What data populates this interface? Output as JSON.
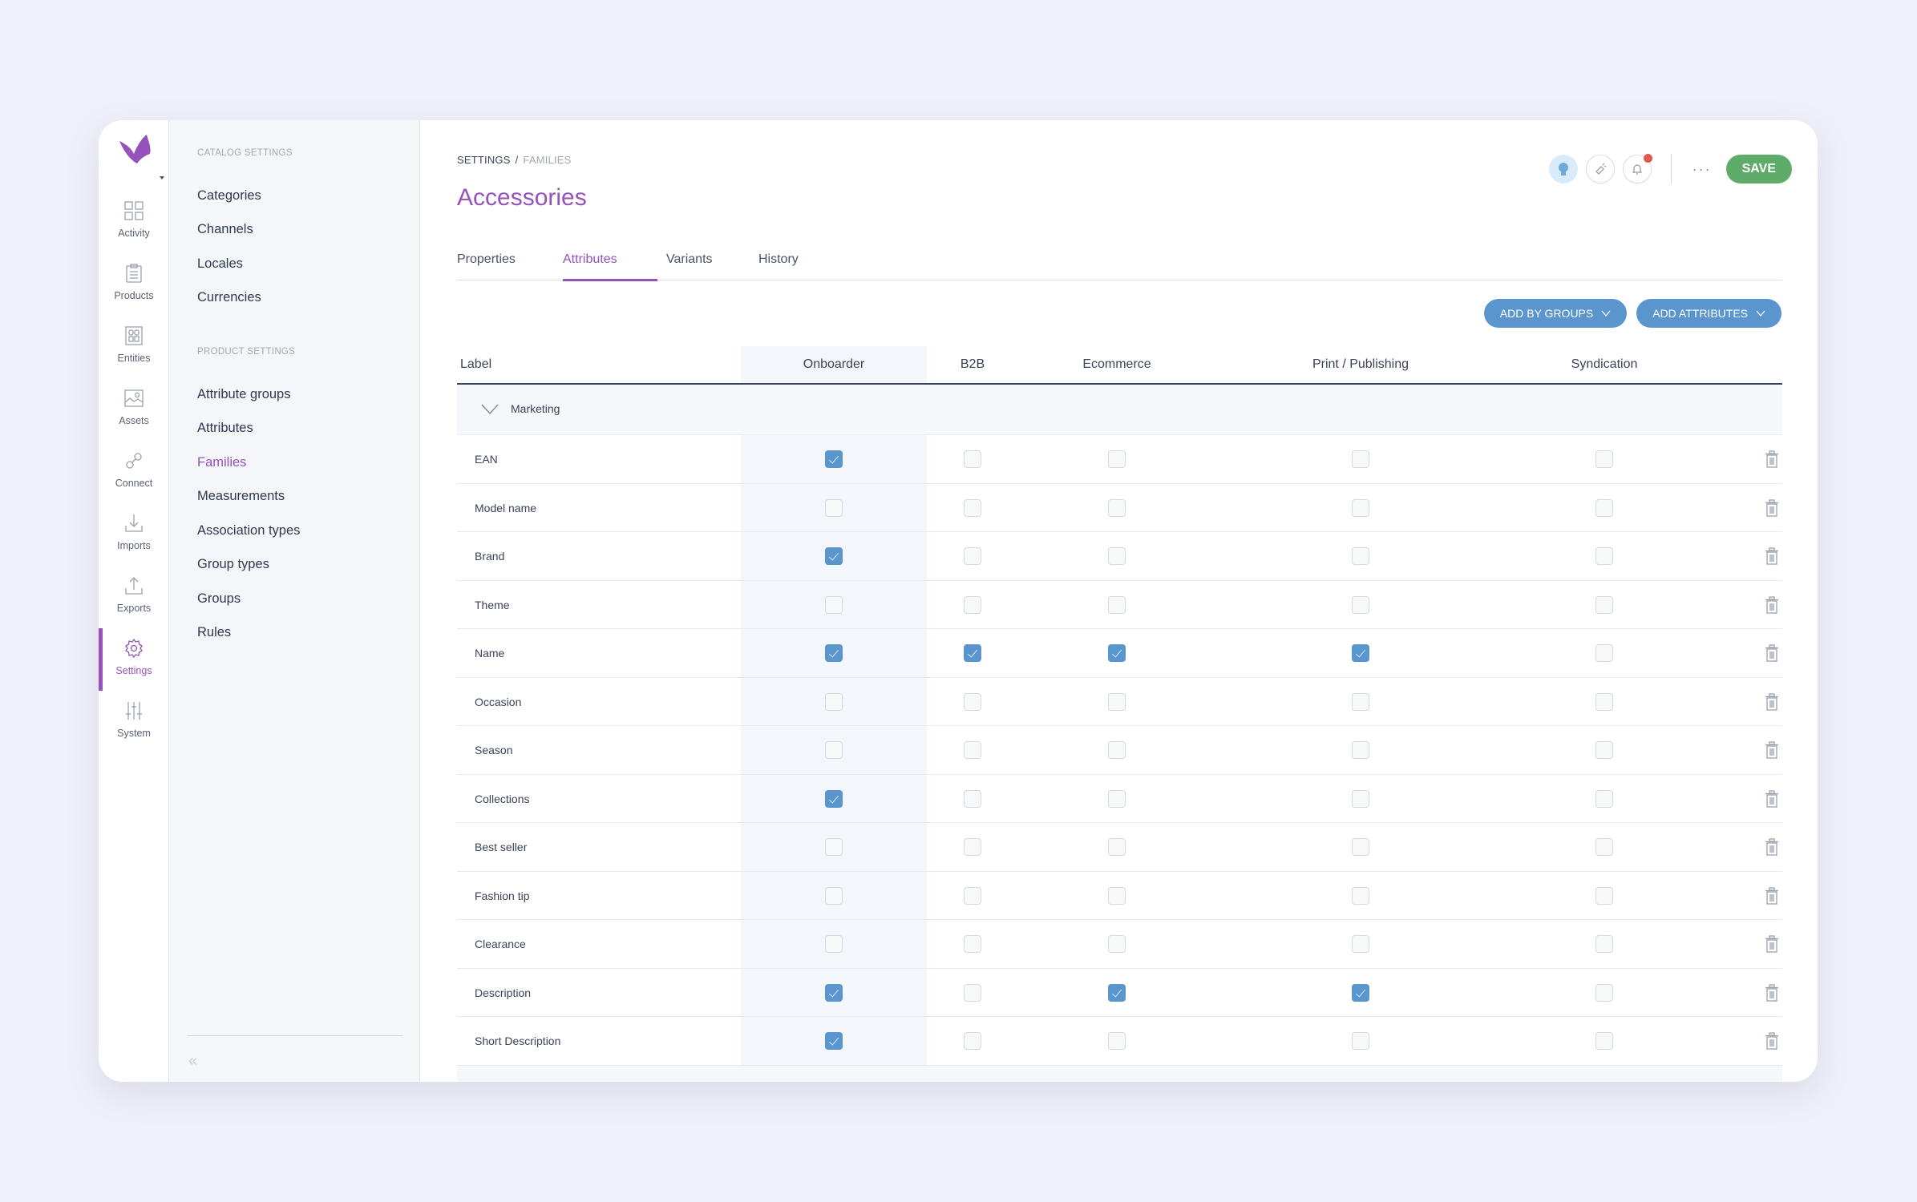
{
  "rail": {
    "items": [
      {
        "label": "Activity",
        "icon": "grid-icon"
      },
      {
        "label": "Products",
        "icon": "clipboard-icon"
      },
      {
        "label": "Entities",
        "icon": "entities-icon"
      },
      {
        "label": "Assets",
        "icon": "image-icon"
      },
      {
        "label": "Connect",
        "icon": "link-icon"
      },
      {
        "label": "Imports",
        "icon": "import-icon"
      },
      {
        "label": "Exports",
        "icon": "export-icon"
      },
      {
        "label": "Settings",
        "icon": "gear-icon",
        "active": true
      },
      {
        "label": "System",
        "icon": "sliders-icon"
      }
    ]
  },
  "panel": {
    "catalog_section": "Catalog settings",
    "catalog_items": [
      "Categories",
      "Channels",
      "Locales",
      "Currencies"
    ],
    "product_section": "Product settings",
    "product_items": [
      "Attribute groups",
      "Attributes",
      "Families",
      "Measurements",
      "Association types",
      "Group types",
      "Groups",
      "Rules"
    ],
    "active_item": "Families",
    "collapse_icon": "«"
  },
  "header": {
    "breadcrumb": [
      "SETTINGS",
      "FAMILIES"
    ],
    "breadcrumb_sep": "/",
    "title": "Accessories",
    "more_label": "···",
    "save_label": "SAVE"
  },
  "tabs": [
    {
      "label": "Properties"
    },
    {
      "label": "Attributes",
      "active": true
    },
    {
      "label": "Variants"
    },
    {
      "label": "History"
    }
  ],
  "actions": {
    "add_by_groups": "ADD BY GROUPS",
    "add_attributes": "ADD ATTRIBUTES"
  },
  "table": {
    "columns": [
      "Label",
      "Onboarder",
      "B2B",
      "Ecommerce",
      "Print / Publishing",
      "Syndication"
    ],
    "group": "Marketing",
    "rows": [
      {
        "label": "EAN",
        "values": [
          true,
          false,
          false,
          false,
          false
        ]
      },
      {
        "label": "Model name",
        "values": [
          false,
          false,
          false,
          false,
          false
        ]
      },
      {
        "label": "Brand",
        "values": [
          true,
          false,
          false,
          false,
          false
        ]
      },
      {
        "label": "Theme",
        "values": [
          false,
          false,
          false,
          false,
          false
        ]
      },
      {
        "label": "Name",
        "values": [
          true,
          true,
          true,
          true,
          false
        ]
      },
      {
        "label": "Occasion",
        "values": [
          false,
          false,
          false,
          false,
          false
        ]
      },
      {
        "label": "Season",
        "values": [
          false,
          false,
          false,
          false,
          false
        ]
      },
      {
        "label": "Collections",
        "values": [
          true,
          false,
          false,
          false,
          false
        ]
      },
      {
        "label": "Best seller",
        "values": [
          false,
          false,
          false,
          false,
          false
        ]
      },
      {
        "label": "Fashion tip",
        "values": [
          false,
          false,
          false,
          false,
          false
        ]
      },
      {
        "label": "Clearance",
        "values": [
          false,
          false,
          false,
          false,
          false
        ]
      },
      {
        "label": "Description",
        "values": [
          true,
          false,
          true,
          true,
          false
        ]
      },
      {
        "label": "Short Description",
        "values": [
          true,
          false,
          false,
          false,
          false
        ]
      }
    ]
  },
  "colors": {
    "accent": "#9452ba",
    "primary_blue": "#5a95cd",
    "save_green": "#5fac6a",
    "notification": "#e05a4c"
  }
}
